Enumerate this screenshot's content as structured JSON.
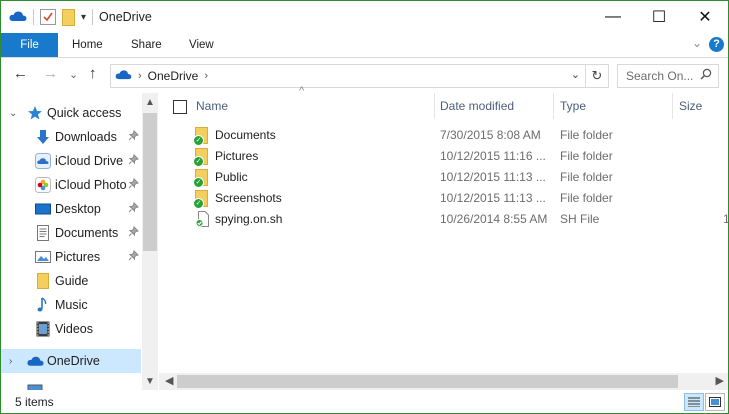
{
  "window": {
    "title": "OneDrive",
    "controls": {
      "minimize": "—",
      "maximize": "☐",
      "close": "✕"
    }
  },
  "quick_access_toolbar": {
    "icons": [
      "onedrive-icon",
      "properties-icon",
      "new-folder-icon",
      "customize-dropdown-icon"
    ]
  },
  "ribbon": {
    "tabs": [
      "File",
      "Home",
      "Share",
      "View"
    ],
    "active_tab": "File",
    "accent": "#1979ca",
    "expand_glyph": "⌄",
    "help_glyph": "?"
  },
  "nav": {
    "back": "←",
    "forward": "→",
    "recent": "⌄",
    "up": "↑",
    "address": {
      "crumbs": [
        "OneDrive"
      ],
      "sep": "›",
      "dropdown": "⌄",
      "refresh": "↻"
    },
    "search": {
      "placeholder": "Search On...",
      "icon": "⚲"
    }
  },
  "sidebar": {
    "quick_access": "Quick access",
    "items": [
      {
        "label": "Downloads",
        "icon": "download-icon",
        "pinned": true
      },
      {
        "label": "iCloud Drive",
        "icon": "icloud-drive-icon",
        "pinned": true
      },
      {
        "label": "iCloud Photo",
        "icon": "icloud-photos-icon",
        "pinned": true
      },
      {
        "label": "Desktop",
        "icon": "desktop-icon",
        "pinned": true
      },
      {
        "label": "Documents",
        "icon": "documents-icon",
        "pinned": true
      },
      {
        "label": "Pictures",
        "icon": "pictures-icon",
        "pinned": true
      },
      {
        "label": "Guide",
        "icon": "folder-icon",
        "pinned": false
      },
      {
        "label": "Music",
        "icon": "music-icon",
        "pinned": false
      },
      {
        "label": "Videos",
        "icon": "videos-icon",
        "pinned": false
      }
    ],
    "onedrive": "OneDrive",
    "pin_glyph": "📌",
    "expand_open": "⌄",
    "expand_closed": "›",
    "selected_bg": "#cce8ff"
  },
  "columns": {
    "name": "Name",
    "date": "Date modified",
    "type": "Type",
    "size": "Size",
    "sort_glyph": "^"
  },
  "files": [
    {
      "name": "Documents",
      "date": "7/30/2015 8:08 AM",
      "type": "File folder",
      "size": "",
      "kind": "folder"
    },
    {
      "name": "Pictures",
      "date": "10/12/2015 11:16 ...",
      "type": "File folder",
      "size": "",
      "kind": "folder"
    },
    {
      "name": "Public",
      "date": "10/12/2015 11:13 ...",
      "type": "File folder",
      "size": "",
      "kind": "folder-shared"
    },
    {
      "name": "Screenshots",
      "date": "10/12/2015 11:13 ...",
      "type": "File folder",
      "size": "",
      "kind": "folder"
    },
    {
      "name": "spying.on.sh",
      "date": "10/26/2014 8:55 AM",
      "type": "SH File",
      "size": "1",
      "kind": "file"
    }
  ],
  "status": {
    "item_count": "5 items"
  },
  "colors": {
    "sync_ok": "#27a335",
    "folder": "#f4cf5d",
    "onedrive": "#1a66c4",
    "window_border": "#2e8b2e"
  }
}
